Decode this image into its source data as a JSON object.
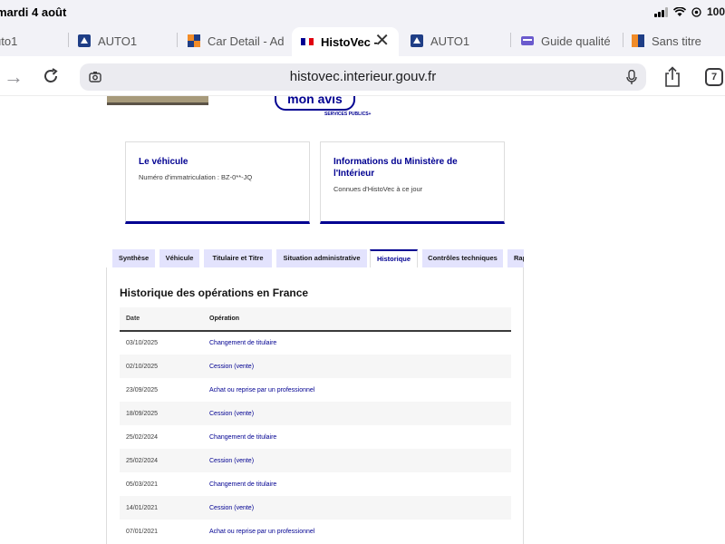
{
  "status_bar": {
    "time": "mardi 4 août",
    "battery": "100"
  },
  "browser": {
    "tabs": [
      {
        "label": "uto1",
        "icon": "tab-icon"
      },
      {
        "label": "AUTO1",
        "icon": "auto1-favicon"
      },
      {
        "label": "Car Detail - Ad",
        "icon": "car-detail-favicon"
      },
      {
        "label": "HistoVec -",
        "icon": "french-flag-favicon"
      },
      {
        "label": "AUTO1",
        "icon": "auto1-favicon"
      },
      {
        "label": "Guide qualité",
        "icon": "guide-favicon"
      },
      {
        "label": "Sans titre",
        "icon": "sans-titre-favicon"
      }
    ],
    "url": "histovec.interieur.gouv.fr",
    "tabs_count": "7"
  },
  "header": {
    "avis_button": "mon avis",
    "services_publics": "SERVICES PUBLICS+"
  },
  "cards": [
    {
      "title": "Le véhicule",
      "desc": "Numéro d'immatriculation : BZ-0**-JQ"
    },
    {
      "title": "Informations du Ministère de l'Intérieur",
      "desc": "Connues d'HistoVec à ce jour"
    }
  ],
  "page_tabs": [
    "Synthèse",
    "Véhicule",
    "Titulaire et Titre",
    "Situation administrative",
    "Historique",
    "Contrôles techniques",
    "Rap"
  ],
  "active_tab": "Historique",
  "history": {
    "title": "Historique des opérations en France",
    "col_date": "Date",
    "col_operation": "Opération",
    "rows": [
      {
        "date": "03/10/2025",
        "operation": "Changement de titulaire"
      },
      {
        "date": "02/10/2025",
        "operation": "Cession (vente)"
      },
      {
        "date": "23/09/2025",
        "operation": "Achat ou reprise par un professionnel"
      },
      {
        "date": "18/09/2025",
        "operation": "Cession (vente)"
      },
      {
        "date": "25/02/2024",
        "operation": "Changement de titulaire"
      },
      {
        "date": "25/02/2024",
        "operation": "Cession (vente)"
      },
      {
        "date": "05/03/2021",
        "operation": "Changement de titulaire"
      },
      {
        "date": "14/01/2021",
        "operation": "Cession (vente)"
      },
      {
        "date": "07/01/2021",
        "operation": "Achat ou reprise par un professionnel"
      }
    ]
  }
}
